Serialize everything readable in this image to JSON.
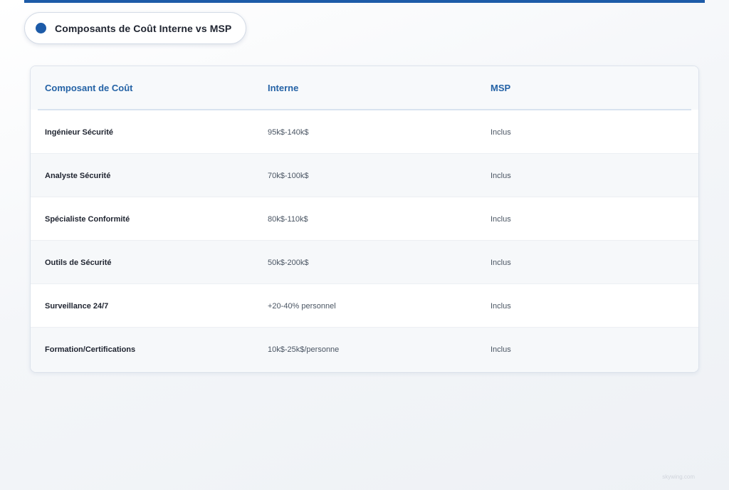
{
  "header": {
    "title": "Composants de Coût Interne vs MSP",
    "accent_color": "#1d5ba8"
  },
  "table": {
    "columns": [
      "Composant de Coût",
      "Interne",
      "MSP"
    ],
    "rows": [
      {
        "component": "Ingénieur Sécurité",
        "internal": "95k$-140k$",
        "msp": "Inclus"
      },
      {
        "component": "Analyste Sécurité",
        "internal": "70k$-100k$",
        "msp": "Inclus"
      },
      {
        "component": "Spécialiste Conformité",
        "internal": "80k$-110k$",
        "msp": "Inclus"
      },
      {
        "component": "Outils de Sécurité",
        "internal": "50k$-200k$",
        "msp": "Inclus"
      },
      {
        "component": "Surveillance 24/7",
        "internal": "+20-40% personnel",
        "msp": "Inclus"
      },
      {
        "component": "Formation/Certifications",
        "internal": "10k$-25k$/personne",
        "msp": "Inclus"
      }
    ]
  },
  "footer": {
    "watermark": "skywing.com"
  }
}
